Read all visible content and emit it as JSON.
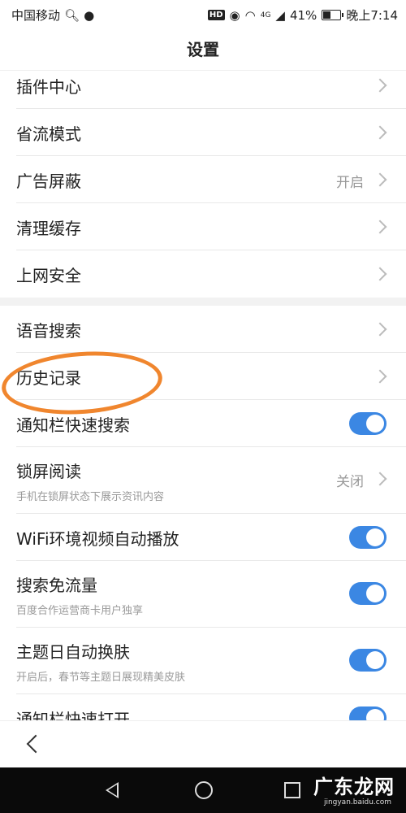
{
  "status_bar": {
    "carrier": "中国移动",
    "hd": "HD",
    "signal": "4G",
    "battery": "41%",
    "battery_level": 0.41,
    "time": "晚上7:14"
  },
  "header": {
    "title": "设置"
  },
  "sections": [
    {
      "items": [
        {
          "label": "插件中心",
          "control": "chevron"
        },
        {
          "label": "省流模式",
          "control": "chevron"
        },
        {
          "label": "广告屏蔽",
          "value": "开启",
          "control": "chevron"
        },
        {
          "label": "清理缓存",
          "control": "chevron"
        },
        {
          "label": "上网安全",
          "control": "chevron"
        }
      ]
    },
    {
      "items": [
        {
          "label": "语音搜索",
          "control": "chevron"
        },
        {
          "label": "历史记录",
          "control": "chevron",
          "annotated": true
        },
        {
          "label": "通知栏快速搜索",
          "control": "toggle",
          "on": true
        },
        {
          "label": "锁屏阅读",
          "subtitle": "手机在锁屏状态下展示资讯内容",
          "value": "关闭",
          "control": "chevron"
        },
        {
          "label": "WiFi环境视频自动播放",
          "control": "toggle",
          "on": true
        },
        {
          "label": "搜索免流量",
          "subtitle": "百度合作运营商卡用户独享",
          "control": "toggle",
          "on": true
        },
        {
          "label": "主题日自动换肤",
          "subtitle": "开启后，春节等主题日展现精美皮肤",
          "control": "toggle",
          "on": true
        },
        {
          "label": "通知栏快速打开",
          "control": "toggle",
          "on": true
        }
      ]
    }
  ],
  "colors": {
    "toggle_on": "#3b87e3",
    "annotation": "#f0862e"
  },
  "watermark": {
    "text": "广东龙网",
    "url": "jingyan.baidu.com"
  }
}
